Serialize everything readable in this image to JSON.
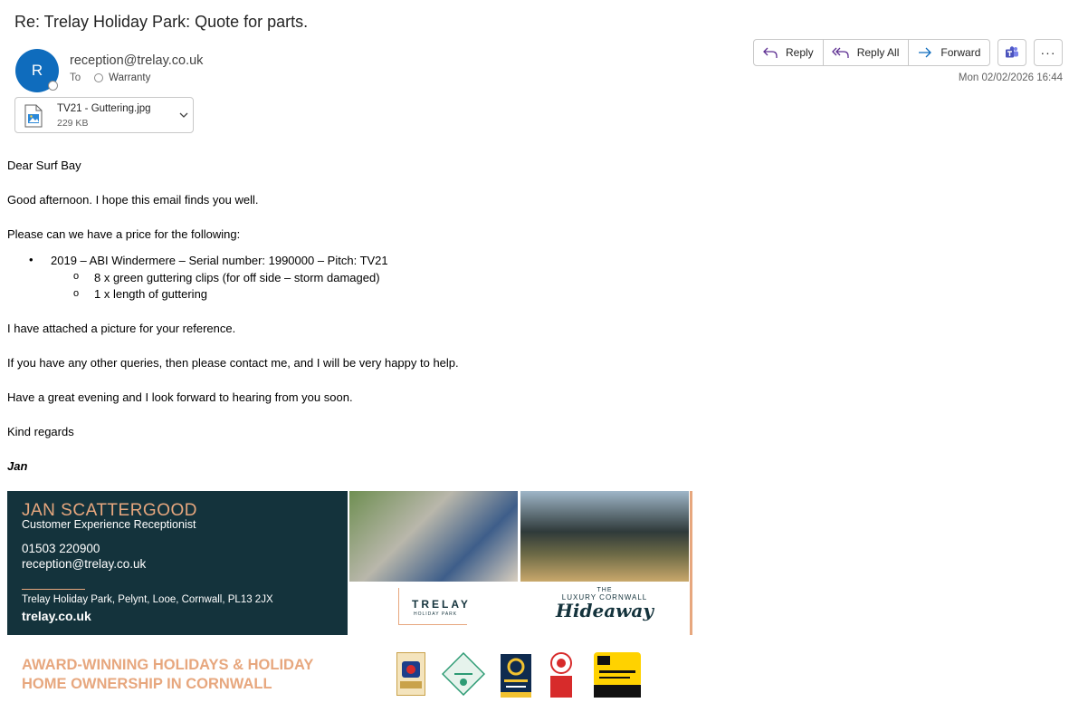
{
  "email": {
    "subject": "Re: Trelay Holiday Park: Quote for parts.",
    "avatar_initial": "R",
    "sender": "reception@trelay.co.uk",
    "to_label": "To",
    "recipient": "Warranty",
    "date": "Mon 02/02/2026 16:44"
  },
  "attachment": {
    "name": "TV21 - Guttering.jpg",
    "size": "229 KB"
  },
  "actions": {
    "reply": "Reply",
    "reply_all": "Reply All",
    "forward": "Forward",
    "more": "···"
  },
  "body": {
    "greeting": "Dear Surf Bay",
    "line1": "Good afternoon. I hope this email finds you well.",
    "line2": "Please can we have a price for the following:",
    "bullet_marker": "•",
    "sub_marker": "o",
    "bullet1": "2019 – ABI Windermere – Serial number: 1990000 – Pitch: TV21",
    "sub1": "8 x green guttering clips (for off side – storm damaged)",
    "sub2": "1 x length of guttering",
    "line3": "I have attached a picture for your reference.",
    "line4": "If you have any other queries, then please contact me, and I will be very happy to help.",
    "line5": "Have a great evening and I look forward to hearing from you soon.",
    "closing": "Kind regards",
    "signature": "Jan"
  },
  "banner": {
    "name": "JAN SCATTERGOOD",
    "role": "Customer Experience Receptionist",
    "phone": "01503 220900",
    "email": "reception@trelay.co.uk",
    "address": "Trelay Holiday Park, Pelynt, Looe, Cornwall, PL13 2JX",
    "website": "trelay.co.uk",
    "logo1_title": "TRELAY",
    "logo1_sub": "HOLIDAY PARK",
    "logo2_the": "THE",
    "logo2_line": "LUXURY CORNWALL",
    "logo2_script": "Hideaway",
    "award_line1": "AWARD-WINNING HOLIDAYS & HOLIDAY",
    "award_line2": "HOME OWNERSHIP IN CORNWALL"
  },
  "colors": {
    "accent": "#0f6cbd",
    "banner_dark": "#14333c",
    "banner_peach": "#e7a77e"
  }
}
